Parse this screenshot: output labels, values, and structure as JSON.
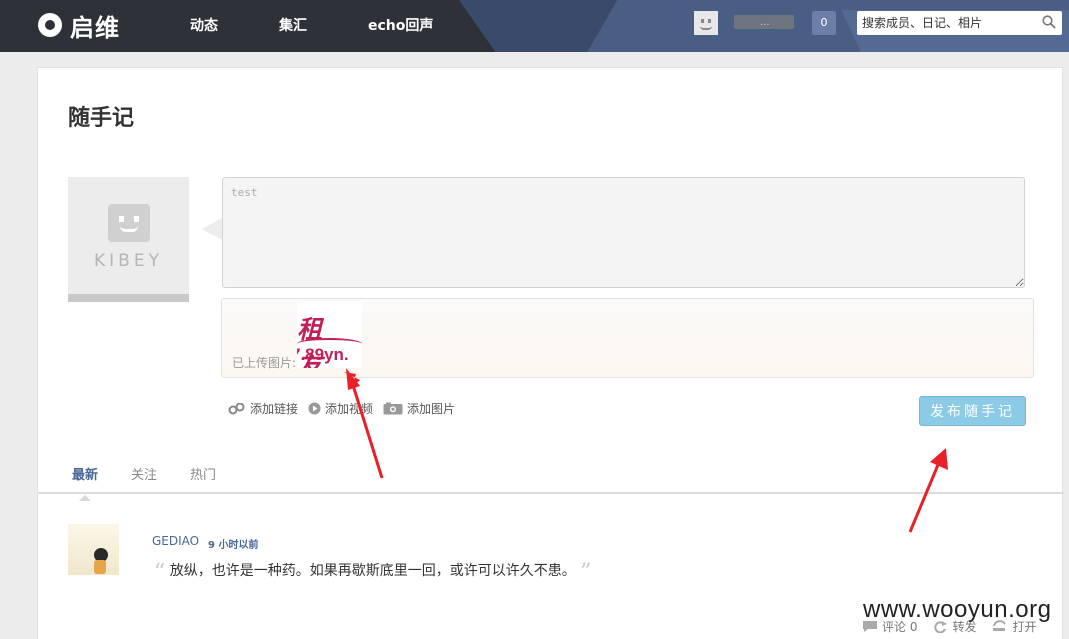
{
  "header": {
    "logo_text": "启维",
    "nav": [
      "动态",
      "集汇",
      "echo回声"
    ],
    "username_truncated": "...",
    "notification_count": "0",
    "search_placeholder": "搜索成员、日记、相片"
  },
  "composer": {
    "title": "随手记",
    "avatar_brand": "KIBEY",
    "text": "test",
    "uploaded_label": "已上传图片:",
    "thumbnail_text_top": "租 友",
    "thumbnail_text_bottom": "7.89yn.",
    "tools": [
      "添加链接",
      "添加视频",
      "添加图片"
    ],
    "publish_label": "发布随手记"
  },
  "tabs": [
    {
      "label": "最新",
      "active": true
    },
    {
      "label": "关注",
      "active": false
    },
    {
      "label": "热门",
      "active": false
    }
  ],
  "post": {
    "author": "GEDIAO",
    "time": "9 小时以前",
    "text": "放纵，也许是一种药。如果再歇斯底里一回，或许可以许久不患。",
    "actions": {
      "comment": "评论 0",
      "repost": "转发",
      "open": "打开"
    }
  },
  "watermark": "www.wooyun.org",
  "colors": {
    "topbar": "#2f3138",
    "accent": "#4a6796",
    "publish": "#8bcbe6",
    "annotation_arrow": "#e8202a"
  }
}
